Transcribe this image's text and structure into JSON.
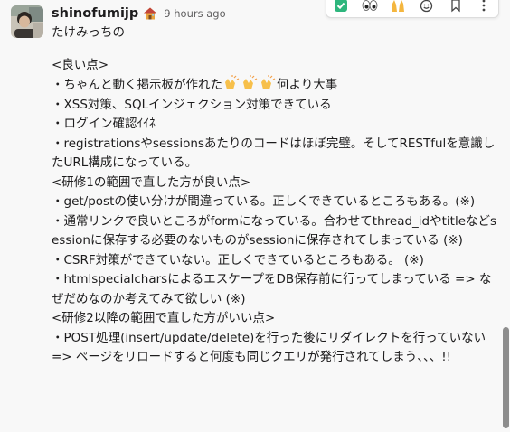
{
  "message": {
    "username": "shinofumijp",
    "timestamp": "9 hours ago",
    "greeting": "たけみっちの",
    "lines": {
      "l01": "<良い点>",
      "l02a": "・ちゃんと動く掲示板が作れた",
      "l02b": "何より大事",
      "l03": "・XSS対策、SQLインジェクション対策できている",
      "l04": "・ログイン確認ｲｲﾈ",
      "l05": "・registrationsやsessionsあたりのコードはほぼ完璧。そしてRESTfulを意識したURL構成になっている。",
      "l06": "<研修1の範囲で直した方が良い点>",
      "l07": "・get/postの使い分けが間違っている。正しくできているところもある。(※)",
      "l08": "・通常リンクで良いところがformになっている。合わせてthread_idやtitleなどsessionに保存する必要のないものがsessionに保存されてしまっている (※)",
      "l09": "・CSRF対策ができていない。正しくできているところもある。 (※)",
      "l10": "・htmlspecialcharsによるエスケープをDB保存前に行ってしまっている => なぜだめなのか考えてみて欲しい (※)",
      "l11": "<研修2以降の範囲で直した方がいい点>",
      "l12": "・POST処理(insert/update/delete)を行った後にリダイレクトを行っていない => ページをリロードすると何度も同じクエリが発行されてしまう、、、!!"
    }
  },
  "icons": {
    "status": "house-emoji",
    "inline_emoji": "clap-emoji",
    "toolbar": [
      "check-reaction-icon",
      "eyes-reaction-icon",
      "raised-hands-reaction-icon",
      "add-reaction-icon",
      "bookmark-icon",
      "more-actions-icon"
    ]
  },
  "colors": {
    "background": "#f8f8f8",
    "text": "#1d1c1d",
    "timestamp": "#616061",
    "check_green": "#2eb67d",
    "scrollbar": "#8d8d8d"
  }
}
